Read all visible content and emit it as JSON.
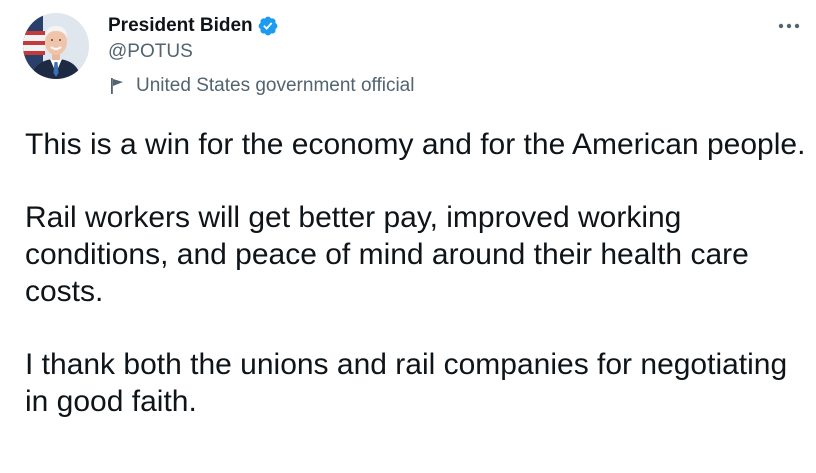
{
  "author": {
    "display_name": "President Biden",
    "handle": "@POTUS",
    "label": "United States government official",
    "verified_icon": "verified-badge-icon",
    "label_icon": "flag-icon"
  },
  "menu": {
    "more_icon": "more-options-icon"
  },
  "tweet": {
    "paragraphs": [
      "This is a win for the economy and for the American people.",
      "Rail workers will get better pay, improved working conditions, and peace of mind around their health care costs.",
      "I thank both the unions and rail companies for negotiating in good faith."
    ]
  },
  "colors": {
    "text_primary": "#0f1419",
    "text_secondary": "#536471",
    "verified_blue": "#1d9bf0"
  }
}
